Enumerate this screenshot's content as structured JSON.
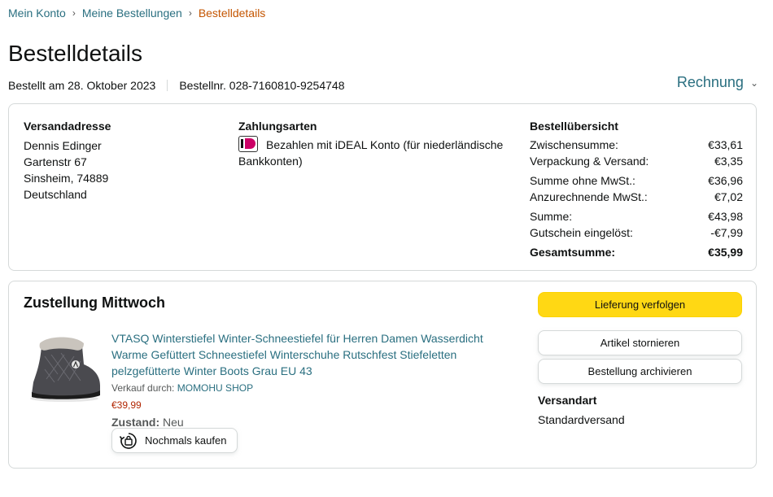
{
  "breadcrumb": {
    "items": [
      "Mein Konto",
      "Meine Bestellungen"
    ],
    "current": "Bestelldetails",
    "separator": "›"
  },
  "page_title": "Bestelldetails",
  "order_meta": {
    "ordered": "Bestellt am 28. Oktober 2023",
    "order_number": "Bestellnr. 028-7160810-9254748"
  },
  "invoice": {
    "label": "Rechnung",
    "icon": "chevron-down-icon"
  },
  "shipping_address": {
    "heading": "Versandadresse",
    "lines": [
      "Dennis Edinger",
      "Gartenstr 67",
      "Sinsheim, 74889",
      "Deutschland"
    ]
  },
  "payment": {
    "heading": "Zahlungsarten",
    "icon": "ideal-icon",
    "method": "Bezahlen mit iDEAL Konto (für niederländische Bankkonten)"
  },
  "summary": {
    "heading": "Bestellübersicht",
    "rows": [
      {
        "label": "Zwischensumme:",
        "value": "€33,61"
      },
      {
        "label": "Verpackung & Versand:",
        "value": "€3,35"
      },
      {
        "label": "Summe ohne MwSt.:",
        "value": "€36,96"
      },
      {
        "label": "Anzurechnende MwSt.:",
        "value": "€7,02"
      },
      {
        "label": "Summe:",
        "value": "€43,98"
      },
      {
        "label": "Gutschein eingelöst:",
        "value": "-€7,99"
      }
    ],
    "total": {
      "label": "Gesamtsumme:",
      "value": "€35,99"
    }
  },
  "delivery": {
    "title": "Zustellung Mittwoch",
    "product": {
      "title": "VTASQ Winterstiefel Winter-Schneestiefel für Herren Damen Wasserdicht Warme Gefüttert Schneestiefel Winterschuhe Rutschfest Stiefeletten pelzgefütterte Winter Boots Grau EU 43",
      "seller_prefix": "Verkauf durch:",
      "seller": "MOMOHU SHOP",
      "price": "€39,99",
      "condition_label": "Zustand:",
      "condition": "Neu",
      "rebuy_label": "Nochmals kaufen"
    },
    "actions": {
      "track": "Lieferung verfolgen",
      "cancel": "Artikel stornieren",
      "archive": "Bestellung archivieren"
    },
    "shipping_method": {
      "heading": "Versandart",
      "value": "Standardversand"
    }
  },
  "colors": {
    "link": "#2a6f80",
    "breadcrumb_current": "#c45500",
    "price": "#b12704",
    "primary_button": "#ffd814",
    "border": "#d5d9d9"
  }
}
